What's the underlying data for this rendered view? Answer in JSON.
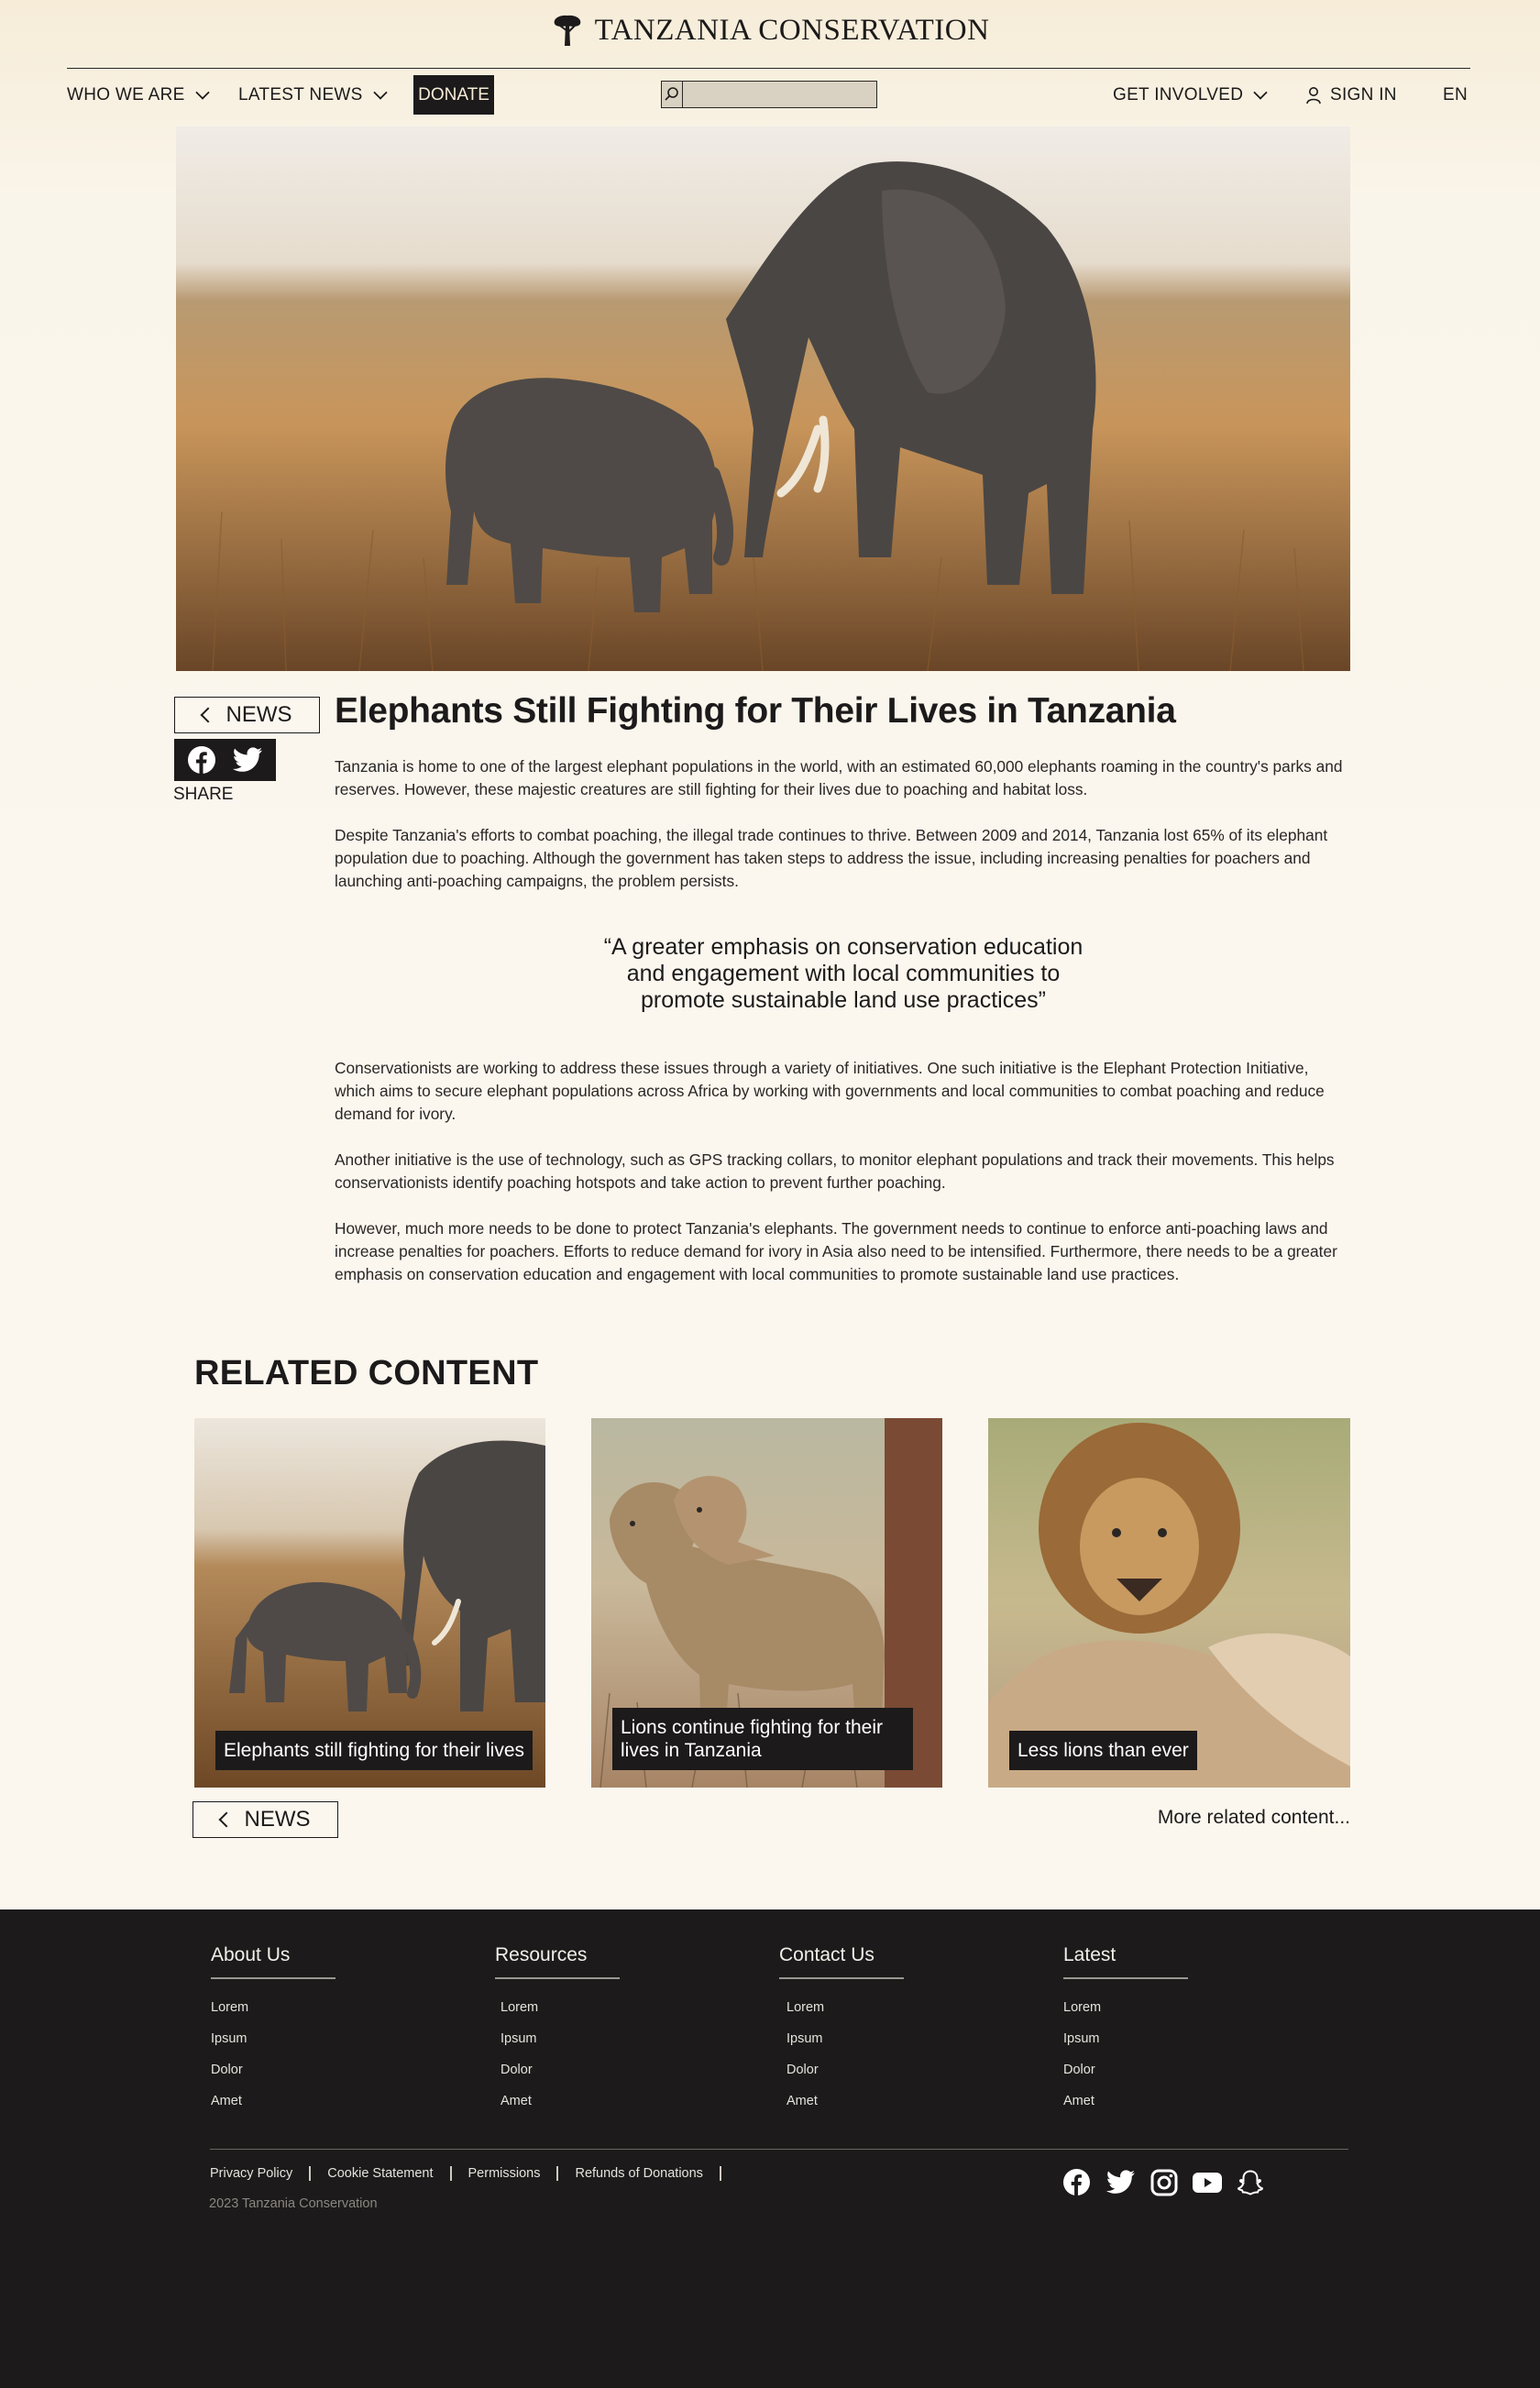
{
  "brand": {
    "name": "TANZANIA CONSERVATION"
  },
  "nav": {
    "who_we_are": "WHO WE ARE",
    "latest_news": "LATEST NEWS",
    "donate": "DONATE",
    "search_placeholder": "",
    "get_involved": "GET INVOLVED",
    "sign_in": "SIGN IN",
    "language": "EN"
  },
  "article": {
    "back_label": "NEWS",
    "share_label": "SHARE",
    "title": "Elephants Still Fighting for Their Lives in Tanzania",
    "paragraphs": [
      "Tanzania is home to one of the largest elephant populations in the world, with an estimated 60,000 elephants roaming in the country's parks and reserves. However, these majestic creatures are still fighting for their lives due to poaching and habitat loss.",
      "Despite Tanzania's efforts to combat poaching, the illegal trade continues to thrive. Between 2009 and 2014, Tanzania lost 65% of its elephant population due to poaching. Although the government has taken steps to address the issue, including increasing penalties for poachers and launching anti-poaching campaigns, the problem persists.",
      "Conservationists are working to address these issues through a variety of initiatives. One such initiative is the Elephant Protection Initiative, which aims to secure elephant populations across Africa by working with governments and local communities to combat poaching and reduce demand for ivory.",
      "Another initiative is the use of technology, such as GPS tracking collars, to monitor elephant populations and track their movements. This helps conservationists identify poaching hotspots and take action to prevent further poaching.",
      "However, much more needs to be done to protect Tanzania's elephants. The government needs to continue to enforce anti-poaching laws and increase penalties for poachers. Efforts to reduce demand for ivory in Asia also need to be intensified. Furthermore, there needs to be a greater emphasis on conservation education and engagement with local communities to promote sustainable land use practices."
    ],
    "quote": "“A greater emphasis on conservation education and engagement with local communities to promote sustainable land use practices”"
  },
  "related": {
    "heading": "RELATED CONTENT",
    "cards": [
      {
        "caption": "Elephants still fighting for their lives"
      },
      {
        "caption": "Lions continue fighting for their lives in Tanzania"
      },
      {
        "caption": "Less lions than ever"
      }
    ],
    "back_label": "NEWS",
    "more_label": "More related content..."
  },
  "footer": {
    "columns": [
      {
        "title": "About Us",
        "links": [
          "Lorem",
          "Ipsum",
          "Dolor",
          "Amet"
        ]
      },
      {
        "title": "Resources",
        "links": [
          "Lorem",
          "Ipsum",
          "Dolor",
          "Amet"
        ]
      },
      {
        "title": "Contact Us",
        "links": [
          "Lorem",
          "Ipsum",
          "Dolor",
          "Amet"
        ]
      },
      {
        "title": "Latest",
        "links": [
          "Lorem",
          "Ipsum",
          "Dolor",
          "Amet"
        ]
      }
    ],
    "legal_links": [
      "Privacy Policy",
      "Cookie Statement",
      "Permissions",
      "Refunds of Donations"
    ],
    "copyright": "2023 Tanzania Conservation",
    "social_icons": [
      "facebook-icon",
      "twitter-icon",
      "instagram-icon",
      "youtube-icon",
      "snapchat-icon"
    ]
  },
  "colors": {
    "ink": "#1c1a1a",
    "background": "#fbf7ef",
    "header_background": "#f6ecd8",
    "footer_background": "#1c1a1a"
  }
}
